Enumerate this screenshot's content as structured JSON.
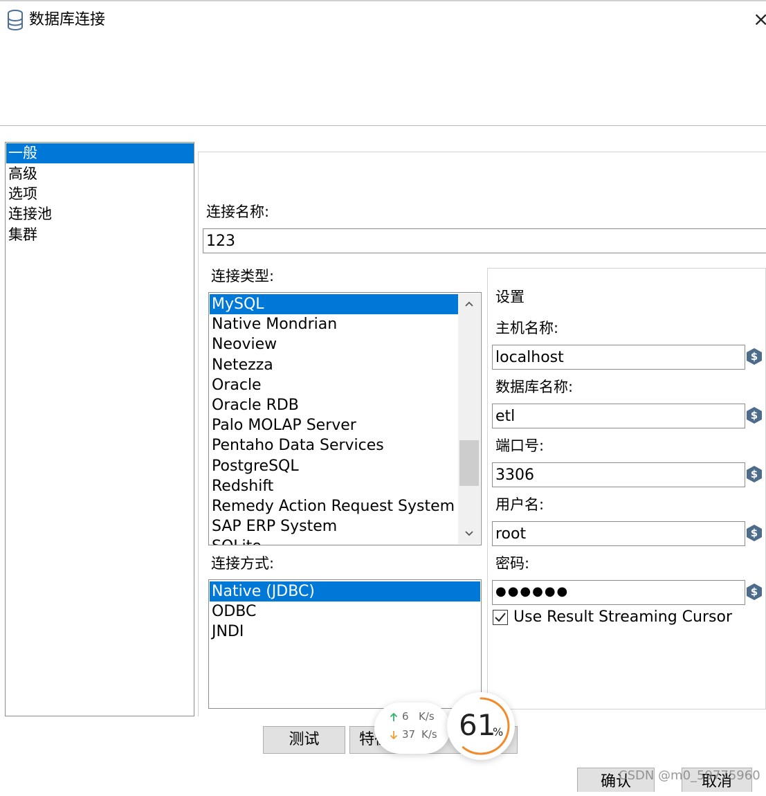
{
  "window": {
    "title": "数据库连接",
    "close_glyph": "×",
    "icon": "database-icon"
  },
  "nav": {
    "items": [
      "一般",
      "高级",
      "选项",
      "连接池",
      "集群"
    ],
    "selected_index": 0
  },
  "connection_name": {
    "label": "连接名称:",
    "value": "123"
  },
  "connection_type": {
    "label": "连接类型:",
    "items": [
      "MySQL",
      "Native Mondrian",
      "Neoview",
      "Netezza",
      "Oracle",
      "Oracle RDB",
      "Palo MOLAP Server",
      "Pentaho Data Services",
      "PostgreSQL",
      "Redshift",
      "Remedy Action Request System",
      "SAP ERP System",
      "SQLite"
    ],
    "selected": "MySQL",
    "scroll_up": "^",
    "scroll_down": "v"
  },
  "access_method": {
    "label": "连接方式:",
    "items": [
      "Native (JDBC)",
      "ODBC",
      "JNDI"
    ],
    "selected": "Native (JDBC)"
  },
  "settings": {
    "title": "设置",
    "host_label": "主机名称:",
    "host_value": "localhost",
    "db_label": "数据库名称:",
    "db_value": "etl",
    "port_label": "端口号:",
    "port_value": "3306",
    "user_label": "用户名:",
    "user_value": "root",
    "password_label": "密码:",
    "password_value": "●●●●●●",
    "streaming_label": "Use Result Streaming Cursor",
    "streaming_checked": true,
    "variable_icon": "variable-dollar-icon"
  },
  "buttons": {
    "test": "测试",
    "features": "特征",
    "ok": "确认",
    "cancel": "取消"
  },
  "overlay": {
    "upload_value": "6",
    "upload_unit": "K/s",
    "download_value": "37",
    "download_unit": "K/s",
    "cpu_value": "61",
    "cpu_unit": "%",
    "cpu_fraction": 0.61,
    "up_color": "#2fb36b",
    "down_color": "#f0a030",
    "gauge_color": "#f08a2a"
  },
  "watermark": "CSDN @m0_59775960",
  "colors": {
    "selection": "#0078d7",
    "button_bg": "#e1e1e1"
  }
}
